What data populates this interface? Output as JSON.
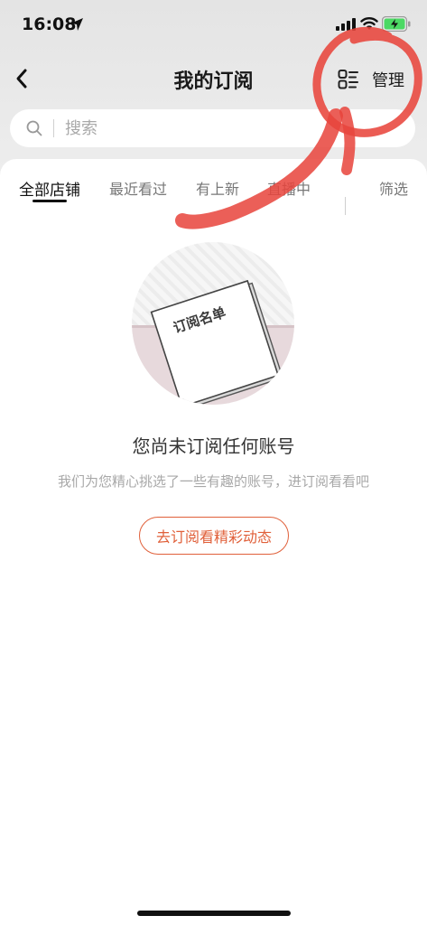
{
  "status_bar": {
    "time": "16:08"
  },
  "nav": {
    "title": "我的订阅",
    "manage_label": "管理"
  },
  "search": {
    "placeholder": "搜索"
  },
  "tabs": [
    {
      "label": "全部店铺",
      "active": true
    },
    {
      "label": "最近看过",
      "active": false
    },
    {
      "label": "有上新",
      "active": false
    },
    {
      "label": "直播中",
      "active": false
    }
  ],
  "filter_label": "筛选",
  "illustration": {
    "card_text": "订阅名单"
  },
  "empty_state": {
    "title": "您尚未订阅任何账号",
    "subtitle": "我们为您精心挑选了一些有趣的账号，进订阅看看吧",
    "button_label": "去订阅看精彩动态"
  },
  "colors": {
    "accent": "#e0603a",
    "annotation": "#e8453c"
  }
}
